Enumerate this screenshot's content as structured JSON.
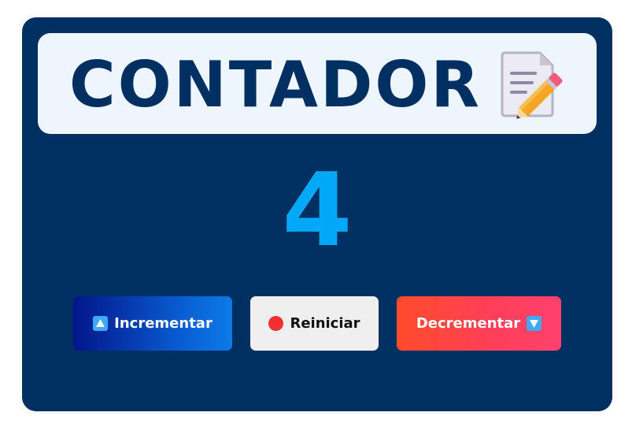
{
  "title": {
    "text": "CONTADOR",
    "icon": "memo-icon"
  },
  "counter": {
    "value": "4"
  },
  "buttons": {
    "increment": {
      "label": "Incrementar",
      "icon": "up-triangle-icon"
    },
    "reset": {
      "label": "Reiniciar",
      "icon": "red-circle-icon"
    },
    "decrement": {
      "label": "Decrementar",
      "icon": "down-triangle-icon"
    }
  },
  "colors": {
    "card_background": "#002f61",
    "title_box_background": "#eef6fd",
    "title_text": "#002f61",
    "counter_text": "#00a8f5",
    "increment_gradient": [
      "#03168a",
      "#0d7ae8"
    ],
    "reset_background": "#efefef",
    "decrement_gradient": [
      "#ff4b2b",
      "#ff416c"
    ]
  }
}
